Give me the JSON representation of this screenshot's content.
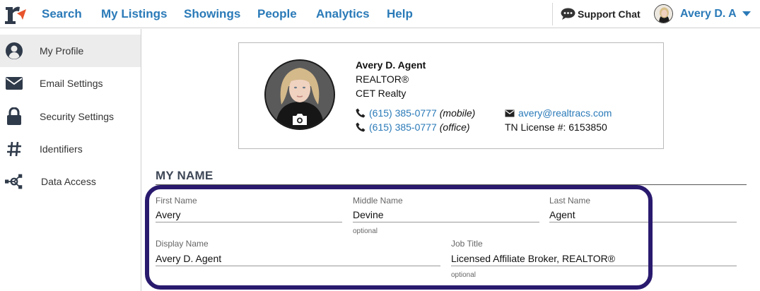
{
  "nav": {
    "items": [
      {
        "label": "Search"
      },
      {
        "label": "My Listings"
      },
      {
        "label": "Showings"
      },
      {
        "label": "People"
      },
      {
        "label": "Analytics"
      },
      {
        "label": "Help"
      }
    ],
    "support_label": "Support Chat",
    "user_name": "Avery D. A"
  },
  "sidebar": {
    "items": [
      {
        "label": "My Profile",
        "icon": "user-circle-icon",
        "active": true
      },
      {
        "label": "Email Settings",
        "icon": "envelope-icon"
      },
      {
        "label": "Security Settings",
        "icon": "lock-icon"
      },
      {
        "label": "Identifiers",
        "icon": "hashtag-icon"
      },
      {
        "label": "Data Access",
        "icon": "network-icon"
      }
    ]
  },
  "profile_card": {
    "name": "Avery D. Agent",
    "title": "REALTOR®",
    "company": "CET Realty",
    "phones": [
      {
        "number": "(615) 385-0777",
        "type": "(mobile)"
      },
      {
        "number": "(615) 385-0777",
        "type": "(office)"
      }
    ],
    "email": "avery@realtracs.com",
    "license": "TN License #: 6153850"
  },
  "section": {
    "title": "MY NAME"
  },
  "form": {
    "first_name": {
      "label": "First Name",
      "value": "Avery"
    },
    "middle_name": {
      "label": "Middle Name",
      "value": "Devine",
      "hint": "optional"
    },
    "last_name": {
      "label": "Last Name",
      "value": "Agent"
    },
    "display_name": {
      "label": "Display Name",
      "value": "Avery D. Agent"
    },
    "job_title": {
      "label": "Job Title",
      "value": "Licensed Affiliate Broker, REALTOR®",
      "hint": "optional"
    }
  },
  "colors": {
    "link": "#2a7ab8",
    "highlight_border": "#2a1a6e",
    "logo_accent": "#e8542c",
    "section_title": "#3e4756"
  }
}
